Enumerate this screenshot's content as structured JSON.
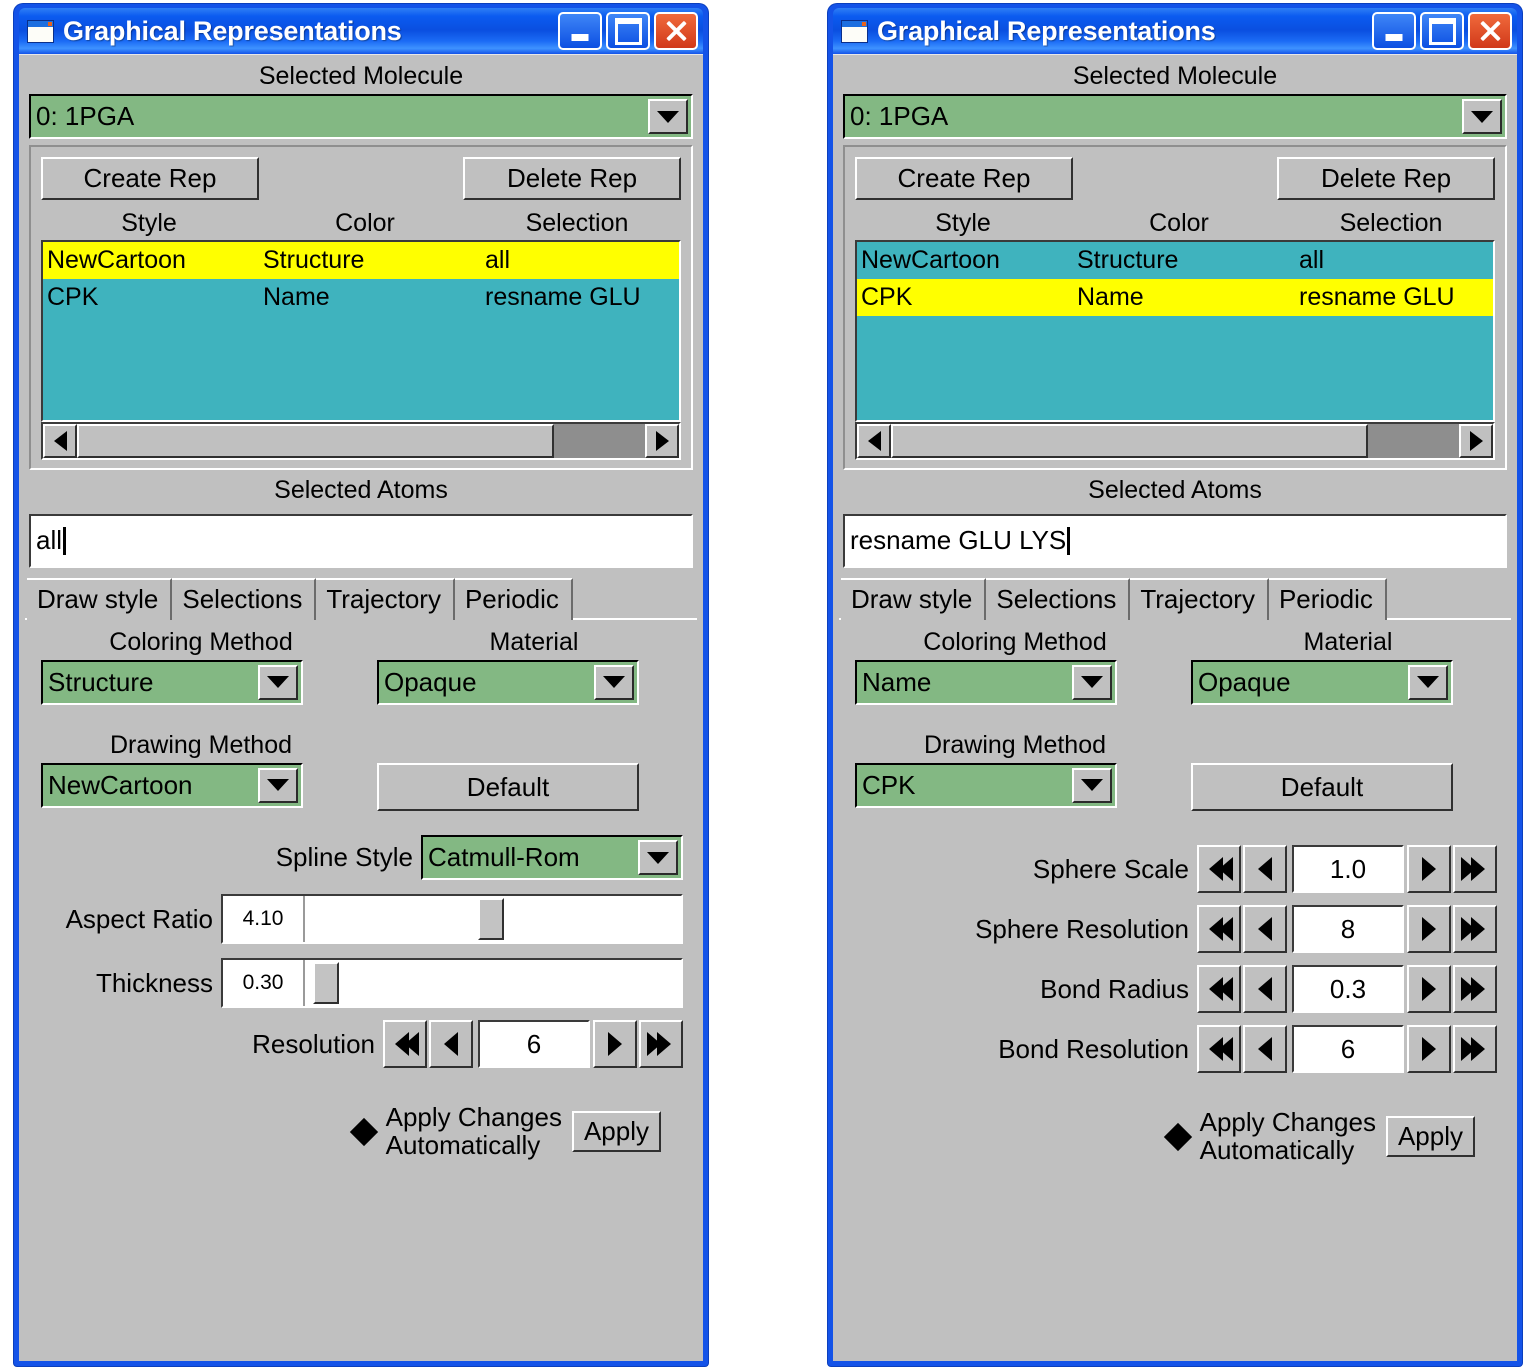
{
  "window": {
    "title": "Graphical Representations",
    "buttons": {
      "minimize": "minimize",
      "maximize": "maximize",
      "close": "close"
    }
  },
  "labels": {
    "selected_molecule": "Selected Molecule",
    "selected_atoms": "Selected Atoms",
    "create_rep": "Create Rep",
    "delete_rep": "Delete Rep",
    "col_style": "Style",
    "col_color": "Color",
    "col_selection": "Selection",
    "coloring_method": "Coloring Method",
    "material": "Material",
    "drawing_method": "Drawing Method",
    "default_btn": "Default",
    "spline_style": "Spline Style",
    "aspect_ratio": "Aspect Ratio",
    "thickness": "Thickness",
    "resolution": "Resolution",
    "sphere_scale": "Sphere Scale",
    "sphere_resolution": "Sphere Resolution",
    "bond_radius": "Bond Radius",
    "bond_resolution": "Bond Resolution",
    "apply_changes_line1": "Apply Changes",
    "apply_changes_line2": "Automatically",
    "apply_btn": "Apply"
  },
  "tabs": [
    {
      "label": "Draw style",
      "active": true
    },
    {
      "label": "Selections",
      "active": false
    },
    {
      "label": "Trajectory",
      "active": false
    },
    {
      "label": "Periodic",
      "active": false
    }
  ],
  "colors": {
    "titlebar_blue": "#1453e8",
    "dialog_gray": "#c0c0c0",
    "listbox_teal": "#3fb3be",
    "selection_yellow": "#ffff00",
    "dropdown_green": "#83b883",
    "close_red": "#d1391a"
  },
  "left": {
    "molecule": "0:  1PGA",
    "reps": [
      {
        "style": "NewCartoon",
        "color": "Structure",
        "selection": "all",
        "selected": true
      },
      {
        "style": "CPK",
        "color": "Name",
        "selection": "resname GLU",
        "selected": false
      }
    ],
    "selected_atoms_value": "all",
    "coloring_method": "Structure",
    "material": "Opaque",
    "drawing_method": "NewCartoon",
    "spline_style": "Catmull-Rom",
    "aspect_ratio": "4.10",
    "aspect_ratio_pct": 46,
    "thickness": "0.30",
    "thickness_pct": 2,
    "resolution": "6"
  },
  "right": {
    "molecule": "0:  1PGA",
    "reps": [
      {
        "style": "NewCartoon",
        "color": "Structure",
        "selection": "all",
        "selected": false
      },
      {
        "style": "CPK",
        "color": "Name",
        "selection": "resname GLU",
        "selected": true
      }
    ],
    "selected_atoms_value": "resname GLU LYS",
    "coloring_method": "Name",
    "material": "Opaque",
    "drawing_method": "CPK",
    "sphere_scale": "1.0",
    "sphere_resolution": "8",
    "bond_radius": "0.3",
    "bond_resolution": "6"
  }
}
